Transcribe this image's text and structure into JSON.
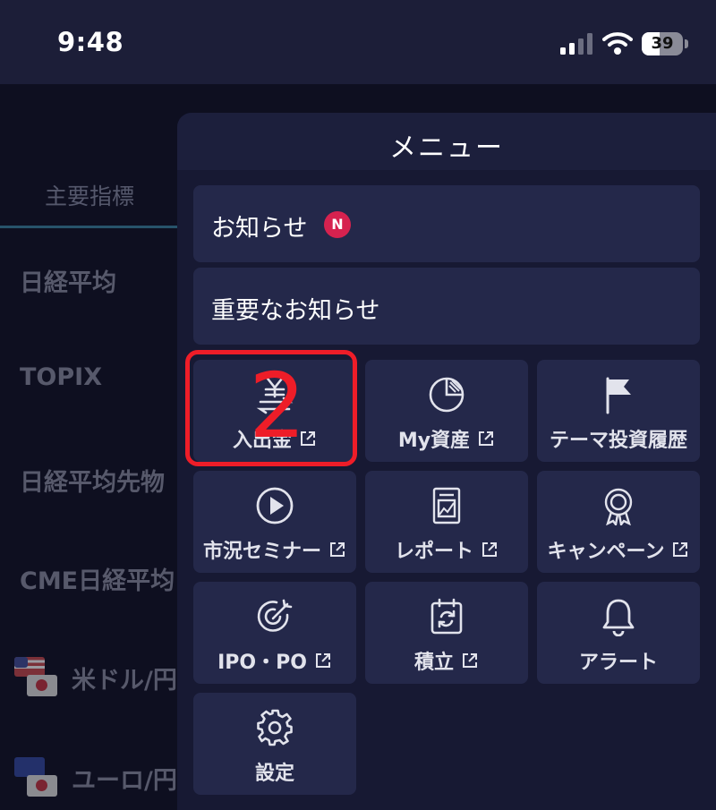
{
  "status_bar": {
    "time": "9:48",
    "battery": "39"
  },
  "background": {
    "tab": "主要指標",
    "rows": [
      "日経平均",
      "TOPIX",
      "日経平均先物",
      "CME日経平均",
      "米ドル/円",
      "ユーロ/円"
    ]
  },
  "menu": {
    "title": "メニュー",
    "notice": {
      "label": "お知らせ",
      "badge": "N"
    },
    "important_notice": {
      "label": "重要なお知らせ"
    },
    "tiles": [
      {
        "label": "入出金",
        "icon": "yen-transfer-icon"
      },
      {
        "label": "My資産",
        "icon": "pie-chart-icon"
      },
      {
        "label": "テーマ投資履歴",
        "icon": "flag-icon"
      },
      {
        "label": "市況セミナー",
        "icon": "play-circle-icon"
      },
      {
        "label": "レポート",
        "icon": "report-document-icon"
      },
      {
        "label": "キャンペーン",
        "icon": "award-ribbon-icon"
      },
      {
        "label": "IPO・PO",
        "icon": "target-icon"
      },
      {
        "label": "積立",
        "icon": "calendar-refresh-icon"
      },
      {
        "label": "アラート",
        "icon": "bell-icon"
      },
      {
        "label": "設定",
        "icon": "gear-icon"
      }
    ]
  },
  "annotation": {
    "text": "2",
    "color": "#ee1d28"
  }
}
